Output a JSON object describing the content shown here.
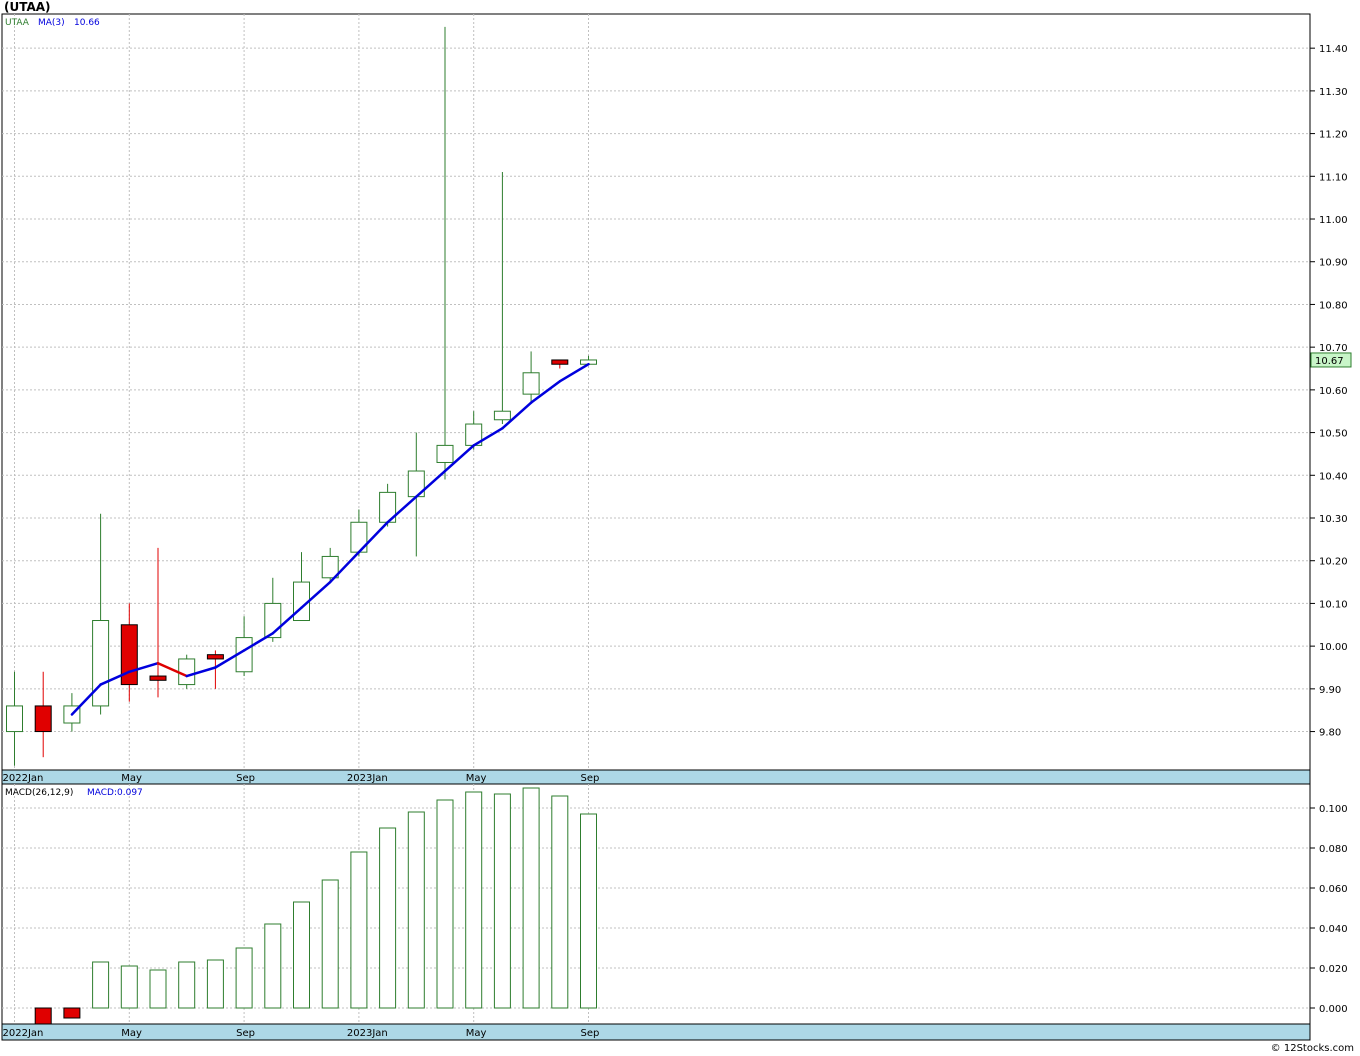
{
  "title": "(UTAA)",
  "copyright": "© 12Stocks.com",
  "colors": {
    "up": "#2e7d2e",
    "down": "#e00000",
    "ma": "#0000dd",
    "ma_down": "#dd0000",
    "grid": "#c0c0c0",
    "axis_band": "#add8e6",
    "last_price_bg": "#c8f5c8"
  },
  "chart_data": [
    {
      "type": "candlestick",
      "ticker_label": "UTAA",
      "ma_label": "MA(3)",
      "ma_value": "10.66",
      "last_price": "10.67",
      "x_tick_labels": [
        "2022Jan",
        "May",
        "Sep",
        "2023Jan",
        "May",
        "Sep"
      ],
      "y_tick_labels": [
        "9.80",
        "9.90",
        "10.00",
        "10.10",
        "10.20",
        "10.30",
        "10.40",
        "10.50",
        "10.60",
        "10.70",
        "10.80",
        "10.90",
        "11.00",
        "11.10",
        "11.20",
        "11.30",
        "11.40"
      ],
      "ylim": [
        9.71,
        11.48
      ],
      "months": [
        "2022-01",
        "2022-02",
        "2022-03",
        "2022-04",
        "2022-05",
        "2022-06",
        "2022-07",
        "2022-08",
        "2022-09",
        "2022-10",
        "2022-11",
        "2022-12",
        "2023-01",
        "2023-02",
        "2023-03",
        "2023-04",
        "2023-05",
        "2023-06",
        "2023-07",
        "2023-08",
        "2023-09"
      ],
      "open": [
        9.8,
        9.86,
        9.82,
        9.86,
        10.05,
        9.93,
        9.91,
        9.98,
        9.94,
        10.02,
        10.06,
        10.16,
        10.22,
        10.29,
        10.35,
        10.43,
        10.47,
        10.53,
        10.59,
        10.67,
        10.66
      ],
      "high": [
        9.94,
        9.94,
        9.89,
        10.31,
        10.1,
        10.23,
        9.98,
        9.99,
        10.07,
        10.16,
        10.22,
        10.23,
        10.32,
        10.38,
        10.5,
        11.45,
        10.55,
        11.11,
        10.69,
        10.67,
        10.68
      ],
      "low": [
        9.72,
        9.74,
        9.8,
        9.84,
        9.87,
        9.88,
        9.9,
        9.9,
        9.93,
        10.01,
        10.06,
        10.15,
        10.21,
        10.28,
        10.21,
        10.39,
        10.46,
        10.52,
        10.57,
        10.65,
        10.66
      ],
      "close": [
        9.86,
        9.8,
        9.86,
        10.06,
        9.91,
        9.92,
        9.97,
        9.97,
        10.02,
        10.1,
        10.15,
        10.21,
        10.29,
        10.36,
        10.41,
        10.47,
        10.52,
        10.55,
        10.64,
        10.66,
        10.67
      ],
      "ma3": [
        null,
        null,
        9.84,
        9.91,
        9.94,
        9.96,
        9.93,
        9.95,
        9.99,
        10.03,
        10.09,
        10.15,
        10.22,
        10.29,
        10.35,
        10.41,
        10.47,
        10.51,
        10.57,
        10.62,
        10.66
      ]
    },
    {
      "type": "bar",
      "label": "MACD(26,12,9)",
      "value_label": "MACD:0.097",
      "x_tick_labels": [
        "2022Jan",
        "May",
        "Sep",
        "2023Jan",
        "May",
        "Sep"
      ],
      "y_tick_labels": [
        "0.000",
        "0.020",
        "0.040",
        "0.060",
        "0.080",
        "0.100"
      ],
      "ylim": [
        -0.008,
        0.112
      ],
      "values": [
        null,
        -0.008,
        -0.005,
        0.023,
        0.021,
        0.019,
        0.023,
        0.024,
        0.03,
        0.042,
        0.053,
        0.064,
        0.078,
        0.09,
        0.098,
        0.104,
        0.108,
        0.107,
        0.11,
        0.106,
        0.097
      ]
    }
  ]
}
